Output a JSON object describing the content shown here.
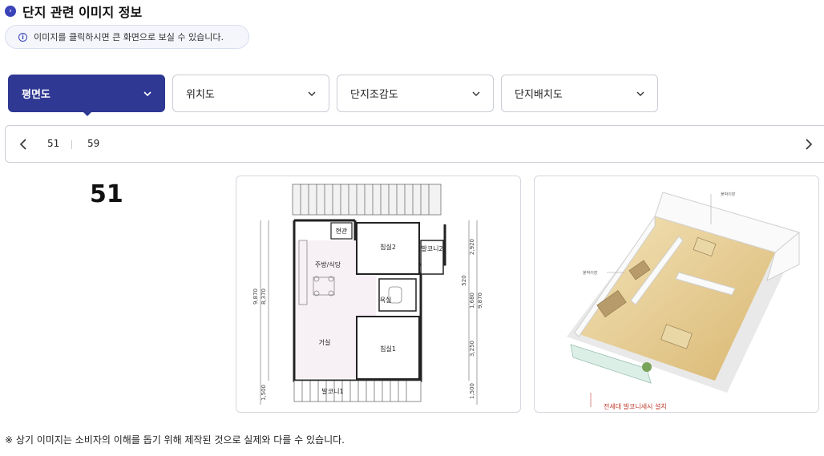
{
  "section": {
    "title": "단지 관련 이미지 정보",
    "title_icon": "chevron-right-circle-icon"
  },
  "notice": {
    "icon": "info-icon",
    "text": "이미지를 클릭하시면 큰 화면으로 보실 수 있습니다."
  },
  "tabs": [
    {
      "label": "평면도",
      "active": true
    },
    {
      "label": "위치도",
      "active": false
    },
    {
      "label": "단지조감도",
      "active": false
    },
    {
      "label": "단지배치도",
      "active": false
    }
  ],
  "sizes": [
    "51",
    "59"
  ],
  "selected_size": "51",
  "floorplan": {
    "rooms": [
      "현관",
      "침실2",
      "발코니2",
      "주방/식당",
      "욕실",
      "거실",
      "침실1",
      "발코니1"
    ],
    "dims_left": [
      "9,870",
      "8,370",
      "1,500"
    ],
    "dims_right": [
      "2,920",
      "520",
      "1,680",
      "9,870",
      "3,250",
      "1,500"
    ]
  },
  "render3d": {
    "labels": [
      "붙박이장",
      "붙박이장"
    ],
    "caption": "전세대 발코니새시 설치"
  },
  "footnote": "※ 상기 이미지는 소비자의 이해를 돕기 위해 제작된 것으로 실제와 다를 수 있습니다.",
  "colors": {
    "accent": "#2f3893",
    "border": "#c8ccd4",
    "caption_red": "#c0392b"
  }
}
